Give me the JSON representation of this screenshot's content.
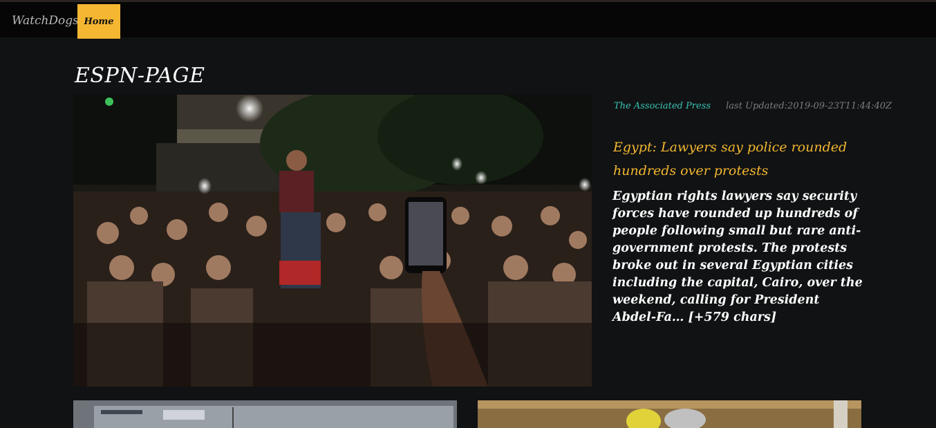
{
  "nav": {
    "brand": "WatchDogs",
    "home_label": "Home"
  },
  "page": {
    "title": "ESPN-PAGE"
  },
  "article": {
    "source": "The Associated Press",
    "updated_label": "last Updated:",
    "updated_value": "2019-09-23T11:44:40Z",
    "headline": "Egypt: Lawyers say police rounded hundreds over protests",
    "summary": "Egyptian rights lawyers say security forces have rounded up hundreds of people following small but rare anti-government protests. The protests broke out in several Egyptian cities including the capital, Cairo, over the weekend, calling for President Abdel-Fa… [+579 chars]"
  },
  "colors": {
    "accent": "#f5b731",
    "source": "#3cc4b6",
    "background": "#101213",
    "navbar": "#060606"
  }
}
